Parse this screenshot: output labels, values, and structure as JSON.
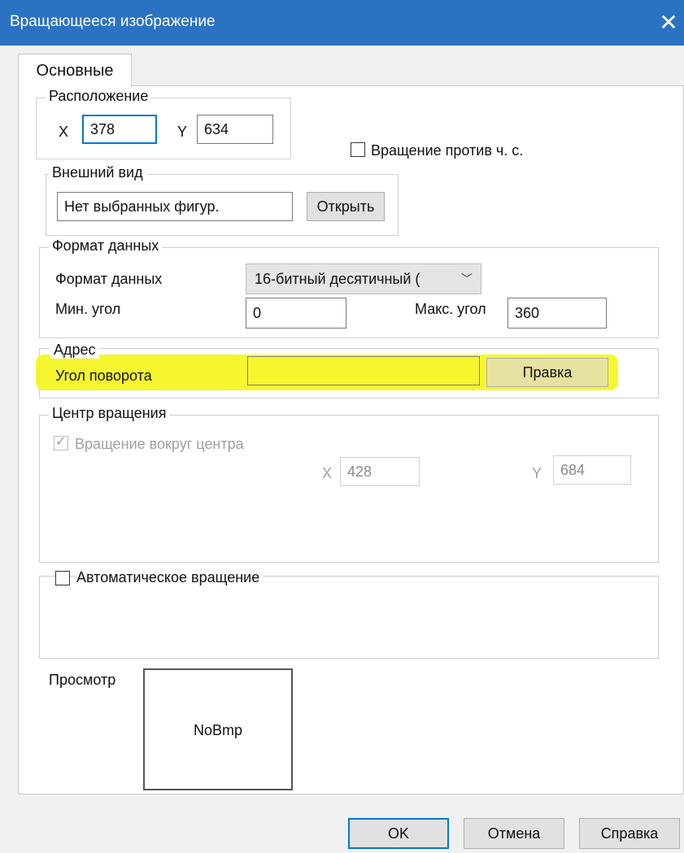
{
  "window": {
    "title": "Вращающееся изображение",
    "close_glyph": "✕"
  },
  "tabs": [
    {
      "label": "Основные",
      "active": true
    }
  ],
  "location": {
    "legend": "Расположение",
    "x_label": "X",
    "x_value": "378",
    "y_label": "Y",
    "y_value": "634"
  },
  "rotate_ccw": {
    "label": "Вращение против ч. с.",
    "checked": false
  },
  "appearance": {
    "legend": "Внешний вид",
    "shape_value": "Нет выбранных фигур.",
    "open_label": "Открыть"
  },
  "data_format": {
    "legend": "Формат данных",
    "format_label": "Формат данных",
    "format_value": "16-битный десятичный (",
    "min_label": "Мин. угол",
    "min_value": "0",
    "max_label": "Макс. угол",
    "max_value": "360"
  },
  "address": {
    "legend": "Адрес",
    "angle_label": "Угол поворота",
    "angle_value": "",
    "edit_label": "Правка",
    "highlight_color": "#f5f50a"
  },
  "rotation_center": {
    "legend": "Центр вращения",
    "around_center_label": "Вращение вокруг центра",
    "around_center_checked": true,
    "x_label": "X",
    "x_value": "428",
    "y_label": "Y",
    "y_value": "684"
  },
  "auto_rotation": {
    "label": "Автоматическое вращение",
    "checked": false
  },
  "preview": {
    "label": "Просмотр",
    "content": "NoBmp"
  },
  "footer": {
    "ok_label": "OK",
    "cancel_label": "Отмена",
    "help_label": "Справка"
  },
  "colors": {
    "titlebar": "#2b72c2",
    "accent": "#0078d7"
  }
}
